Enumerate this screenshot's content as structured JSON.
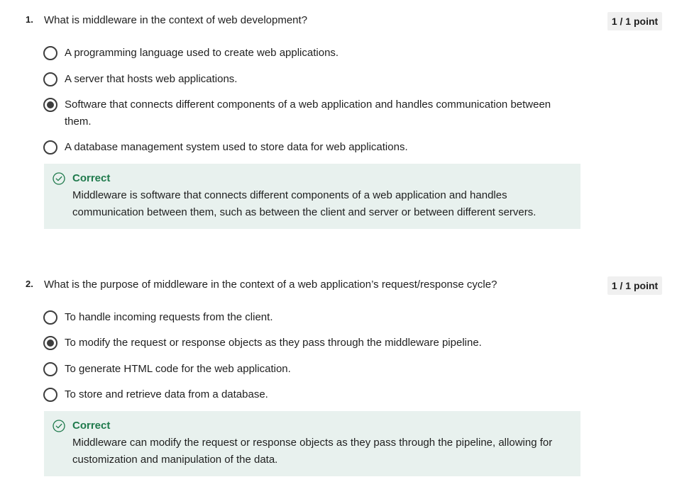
{
  "questions": [
    {
      "number": "1.",
      "text": "What is middleware in the context of web development?",
      "points": "1 / 1 point",
      "options": [
        {
          "label": "A programming language used to create web applications.",
          "selected": false
        },
        {
          "label": "A server that hosts web applications.",
          "selected": false
        },
        {
          "label": "Software that connects different components of a web application and handles communication between them.",
          "selected": true
        },
        {
          "label": "A database management system used to store data for web applications.",
          "selected": false
        }
      ],
      "feedback": {
        "status": "Correct",
        "text": "Middleware is software that connects different components of a web application and handles communication between them, such as between the client and server or between different servers."
      }
    },
    {
      "number": "2.",
      "text": "What is the purpose of middleware in the context of a web application’s request/response cycle?",
      "points": "1 / 1 point",
      "options": [
        {
          "label": "To handle incoming requests from the client.",
          "selected": false
        },
        {
          "label": "To modify the request or response objects as they pass through the middleware pipeline.",
          "selected": true
        },
        {
          "label": "To generate HTML code for the web application.",
          "selected": false
        },
        {
          "label": "To store and retrieve data from a database.",
          "selected": false
        }
      ],
      "feedback": {
        "status": "Correct",
        "text": "Middleware can modify the request or response objects as they pass through the pipeline, allowing for customization and manipulation of the data."
      }
    }
  ],
  "colors": {
    "correct_green": "#1f7a4c",
    "feedback_bg": "#e8f1ee",
    "points_bg": "#f0f0f0"
  },
  "icons": {
    "feedback": "check-circle-icon"
  }
}
